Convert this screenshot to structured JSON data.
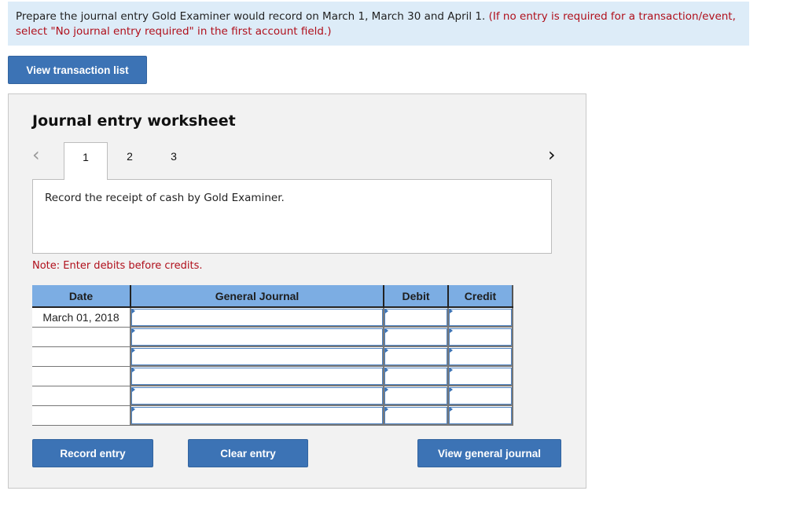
{
  "instructions": {
    "text_main": "Prepare the journal entry Gold Examiner would record on March 1, March 30 and April 1.",
    "text_note": "(If no entry is required for a transaction/event, select \"No journal entry required\" in the first account field.)"
  },
  "buttons": {
    "view_transaction_list": "View transaction list",
    "record_entry": "Record entry",
    "clear_entry": "Clear entry",
    "view_general_journal": "View general journal"
  },
  "worksheet": {
    "title": "Journal entry worksheet",
    "nav_prev_icon": "‹",
    "nav_next_icon": "›",
    "tabs": [
      {
        "label": "1",
        "active": true
      },
      {
        "label": "2",
        "active": false
      },
      {
        "label": "3",
        "active": false
      }
    ],
    "description": "Record the receipt of cash by Gold Examiner.",
    "note": "Note: Enter debits before credits."
  },
  "table": {
    "headers": {
      "date": "Date",
      "general_journal": "General Journal",
      "debit": "Debit",
      "credit": "Credit"
    },
    "rows": [
      {
        "date": "March 01, 2018",
        "account": "",
        "debit": "",
        "credit": ""
      },
      {
        "date": "",
        "account": "",
        "debit": "",
        "credit": ""
      },
      {
        "date": "",
        "account": "",
        "debit": "",
        "credit": ""
      },
      {
        "date": "",
        "account": "",
        "debit": "",
        "credit": ""
      },
      {
        "date": "",
        "account": "",
        "debit": "",
        "credit": ""
      },
      {
        "date": "",
        "account": "",
        "debit": "",
        "credit": ""
      }
    ]
  },
  "colors": {
    "accent_button": "#3c73b5",
    "header_blue": "#7cade3",
    "instruction_bg": "#ddecf8",
    "note_red": "#b00f1b"
  }
}
